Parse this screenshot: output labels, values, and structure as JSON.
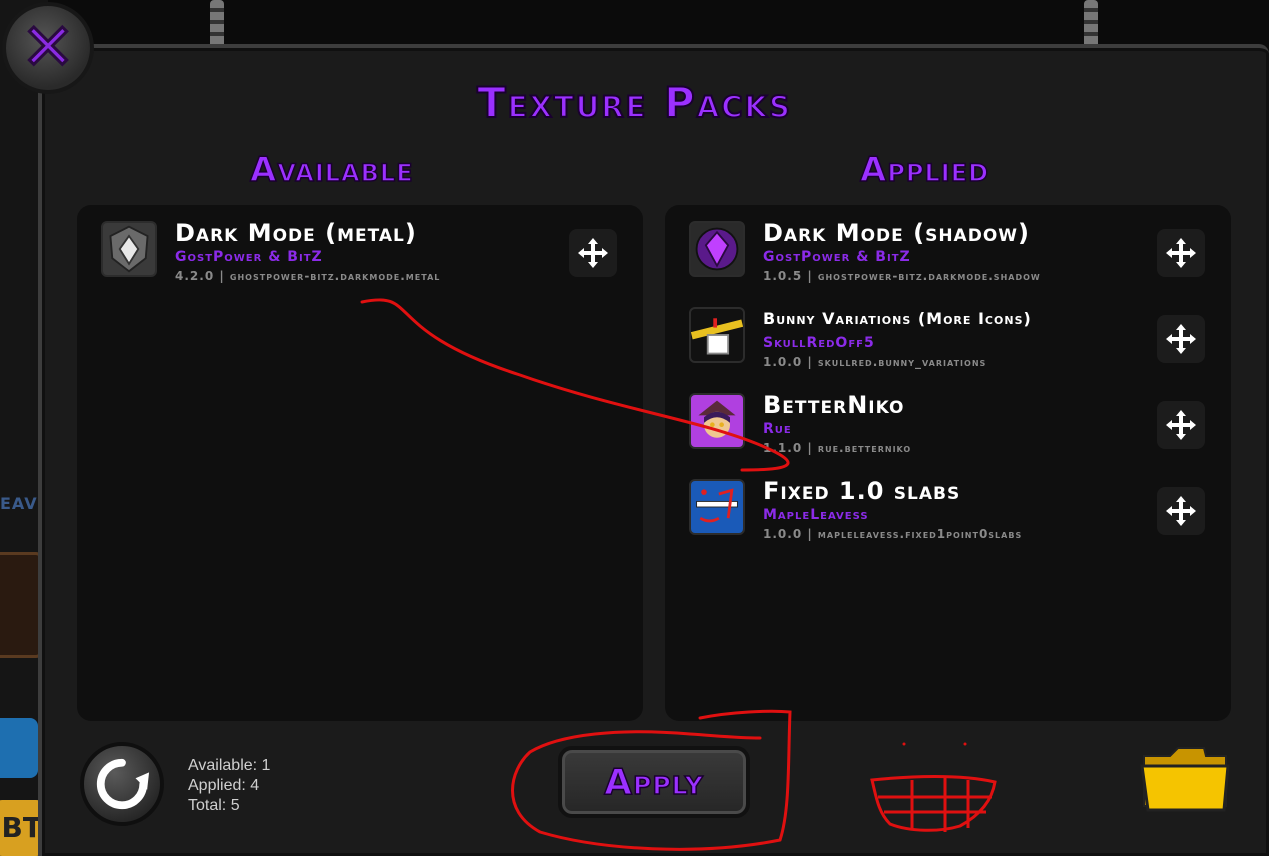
{
  "title": "Texture Packs",
  "available": {
    "heading": "Available",
    "packs": [
      {
        "name": "Dark Mode (metal)",
        "author": "GostPower & BitZ",
        "version": "4.2.0",
        "id": "ghostpower-bitz.darkmode.metal",
        "icon": "metal-shield-icon"
      }
    ]
  },
  "applied": {
    "heading": "Applied",
    "packs": [
      {
        "name": "Dark Mode (shadow)",
        "author": "GostPower & BitZ",
        "version": "1.0.5",
        "id": "ghostpower-bitz.darkmode.shadow",
        "icon": "purple-gem-icon"
      },
      {
        "name": "Bunny Variations (More Icons)",
        "author": "SkullRedOff5",
        "version": "1.0.0",
        "id": "skullred.bunny_variations",
        "icon": "bunny-icon"
      },
      {
        "name": "BetterNiko",
        "author": "Rue",
        "version": "1.1.0",
        "id": "rue.betterniko",
        "icon": "niko-icon"
      },
      {
        "name": "Fixed 1.0 slabs",
        "author": "MapleLeavess",
        "version": "1.0.0",
        "id": "mapleleavess.fixed1point0slabs",
        "icon": "slabs-icon"
      }
    ]
  },
  "stats": {
    "available": "Available: 1",
    "applied": "Applied: 4",
    "total": "Total: 5"
  },
  "apply_label": "Apply",
  "background": {
    "side_text": "EAV",
    "side_button_text": "BT"
  },
  "colors": {
    "accent": "#9b30ff",
    "panel": "#1b1b1b",
    "list": "#0f0f0f",
    "annotation": "#e01010",
    "folder": "#f5c400"
  }
}
